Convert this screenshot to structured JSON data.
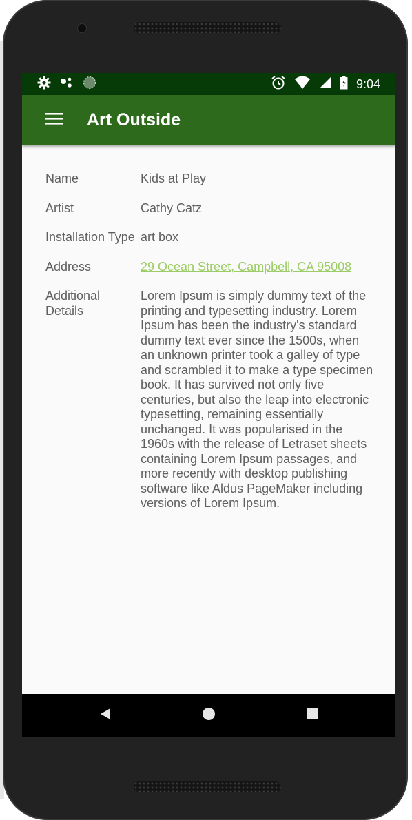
{
  "status_bar": {
    "time": "9:04",
    "icons_left": [
      "settings-icon",
      "assistant-dots-icon",
      "sync-icon"
    ],
    "icons_right": [
      "alarm-icon",
      "wifi-icon",
      "signal-icon",
      "battery-icon"
    ]
  },
  "app_bar": {
    "title": "Art Outside",
    "menu_icon": "hamburger-menu-icon",
    "color": "#2e6a1b"
  },
  "details": {
    "name_label": "Name",
    "name_value": "Kids at Play",
    "artist_label": "Artist",
    "artist_value": "Cathy Catz",
    "type_label": "Installation Type",
    "type_value": "art box",
    "address_label": "Address",
    "address_value": "29 Ocean Street, Campbell, CA 95008",
    "additional_label": "Additional Details",
    "additional_value": "Lorem Ipsum is simply dummy text of the printing and typesetting industry. Lorem Ipsum has been the industry's standard dummy text ever since the 1500s, when an unknown printer took a galley of type and scrambled it to make a type specimen book. It has survived not only five centuries, but also the leap into electronic typesetting, remaining essentially unchanged. It was popularised in the 1960s with the release of Letraset sheets containing Lorem Ipsum passages, and more recently with desktop publishing software like Aldus PageMaker including versions of Lorem Ipsum."
  },
  "nav_bar": {
    "buttons": [
      "back-icon",
      "home-icon",
      "recents-icon"
    ]
  },
  "colors": {
    "status_bar": "#063a06",
    "link": "#9ccc65",
    "text": "#5f5f5f"
  }
}
